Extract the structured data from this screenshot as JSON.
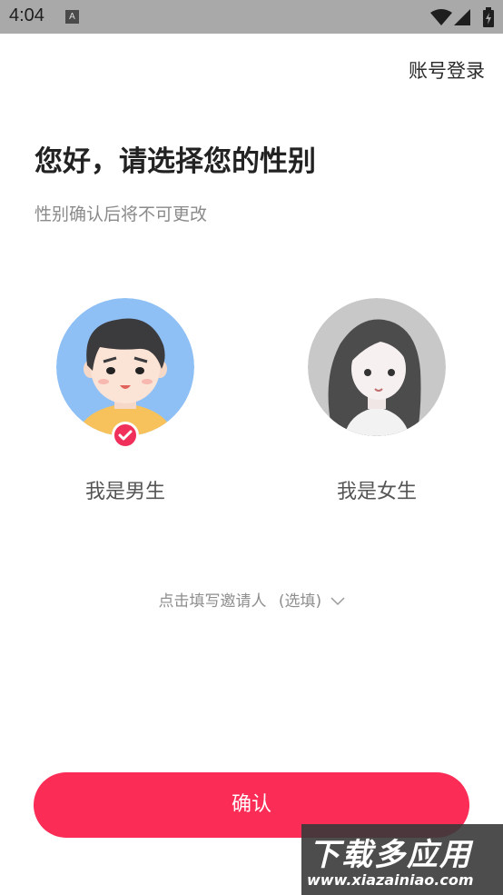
{
  "status_bar": {
    "time": "4:04",
    "notification_glyph": "A"
  },
  "header": {
    "account_login": "账号登录"
  },
  "main": {
    "title": "您好，请选择您的性别",
    "subtitle": "性别确认后将不可更改",
    "options": [
      {
        "label": "我是男生",
        "selected": true
      },
      {
        "label": "我是女生",
        "selected": false
      }
    ],
    "invite": {
      "text": "点击填写邀请人",
      "optional": "(选填)"
    },
    "confirm_label": "确认"
  },
  "watermark": {
    "big": "下载多应用",
    "small": "www.xiazainiao.com"
  },
  "colors": {
    "accent": "#fb2c56",
    "male_bg": "#8ec0f5",
    "female_bg": "#c8c8c8"
  }
}
